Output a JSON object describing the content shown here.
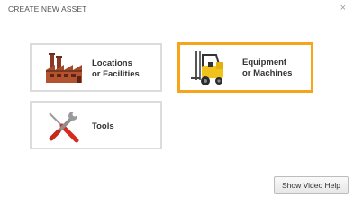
{
  "dialog": {
    "title": "CREATE NEW ASSET",
    "close_glyph": "×"
  },
  "options": [
    {
      "line1": "Locations",
      "line2": "or Facilities",
      "icon": "factory-icon"
    },
    {
      "line1": "Equipment",
      "line2": "or Machines",
      "icon": "forklift-icon",
      "selected": true
    },
    {
      "line1": "Tools",
      "icon": "tools-icon"
    }
  ],
  "footer": {
    "help_button": "Show Video Help"
  },
  "colors": {
    "selected_border": "#f6a51a",
    "card_border": "#dcdcdc"
  }
}
